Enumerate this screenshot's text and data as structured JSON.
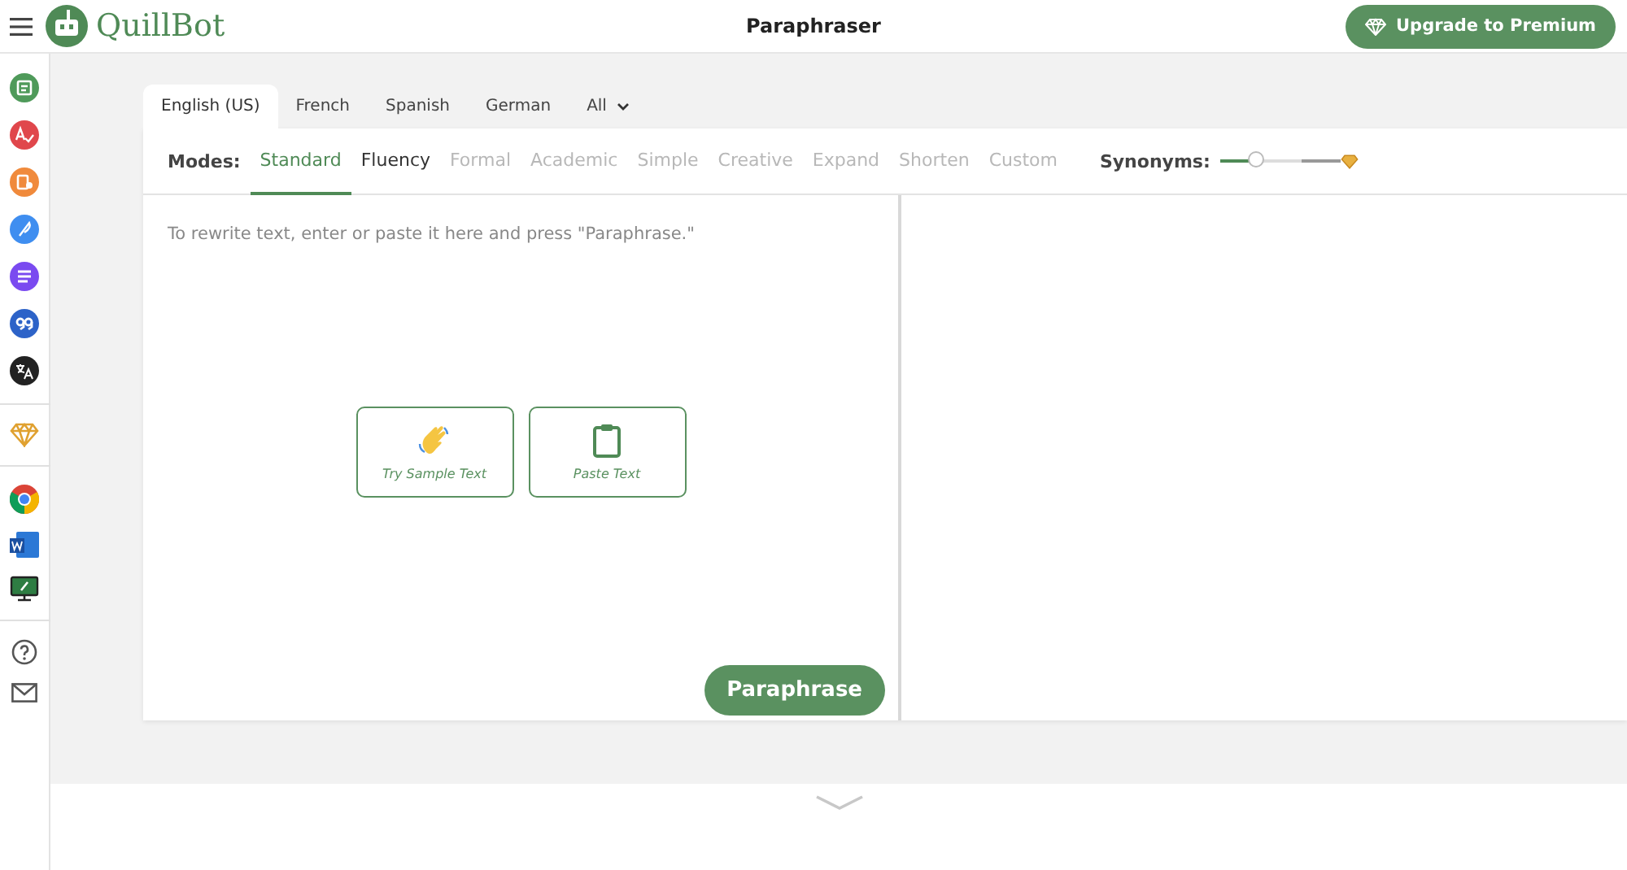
{
  "header": {
    "logo": "QuillBot",
    "title": "Paraphraser",
    "upgrade_button": "Upgrade to Premium"
  },
  "language_tabs": [
    {
      "label": "English (US)",
      "selected": true
    },
    {
      "label": "French",
      "selected": false
    },
    {
      "label": "Spanish",
      "selected": false
    },
    {
      "label": "German",
      "selected": false
    },
    {
      "label": "All",
      "selected": false
    }
  ],
  "modes_label": "Modes:",
  "modes": [
    {
      "label": "Standard",
      "selected": true,
      "disabled": false
    },
    {
      "label": "Fluency",
      "selected": false,
      "disabled": false
    },
    {
      "label": "Formal",
      "selected": false,
      "disabled": true
    },
    {
      "label": "Academic",
      "selected": false,
      "disabled": true
    },
    {
      "label": "Simple",
      "selected": false,
      "disabled": true
    },
    {
      "label": "Creative",
      "selected": false,
      "disabled": true
    },
    {
      "label": "Expand",
      "selected": false,
      "disabled": true
    },
    {
      "label": "Shorten",
      "selected": false,
      "disabled": true
    },
    {
      "label": "Custom",
      "selected": false,
      "disabled": true
    }
  ],
  "synonyms": {
    "label": "Synonyms:",
    "level": 0.3
  },
  "input": {
    "placeholder": "To rewrite text, enter or paste it here and press \"Paraphrase.\""
  },
  "actions": [
    "Try Sample Text",
    "Paste Text"
  ],
  "paraphrase_button": "Paraphrase"
}
